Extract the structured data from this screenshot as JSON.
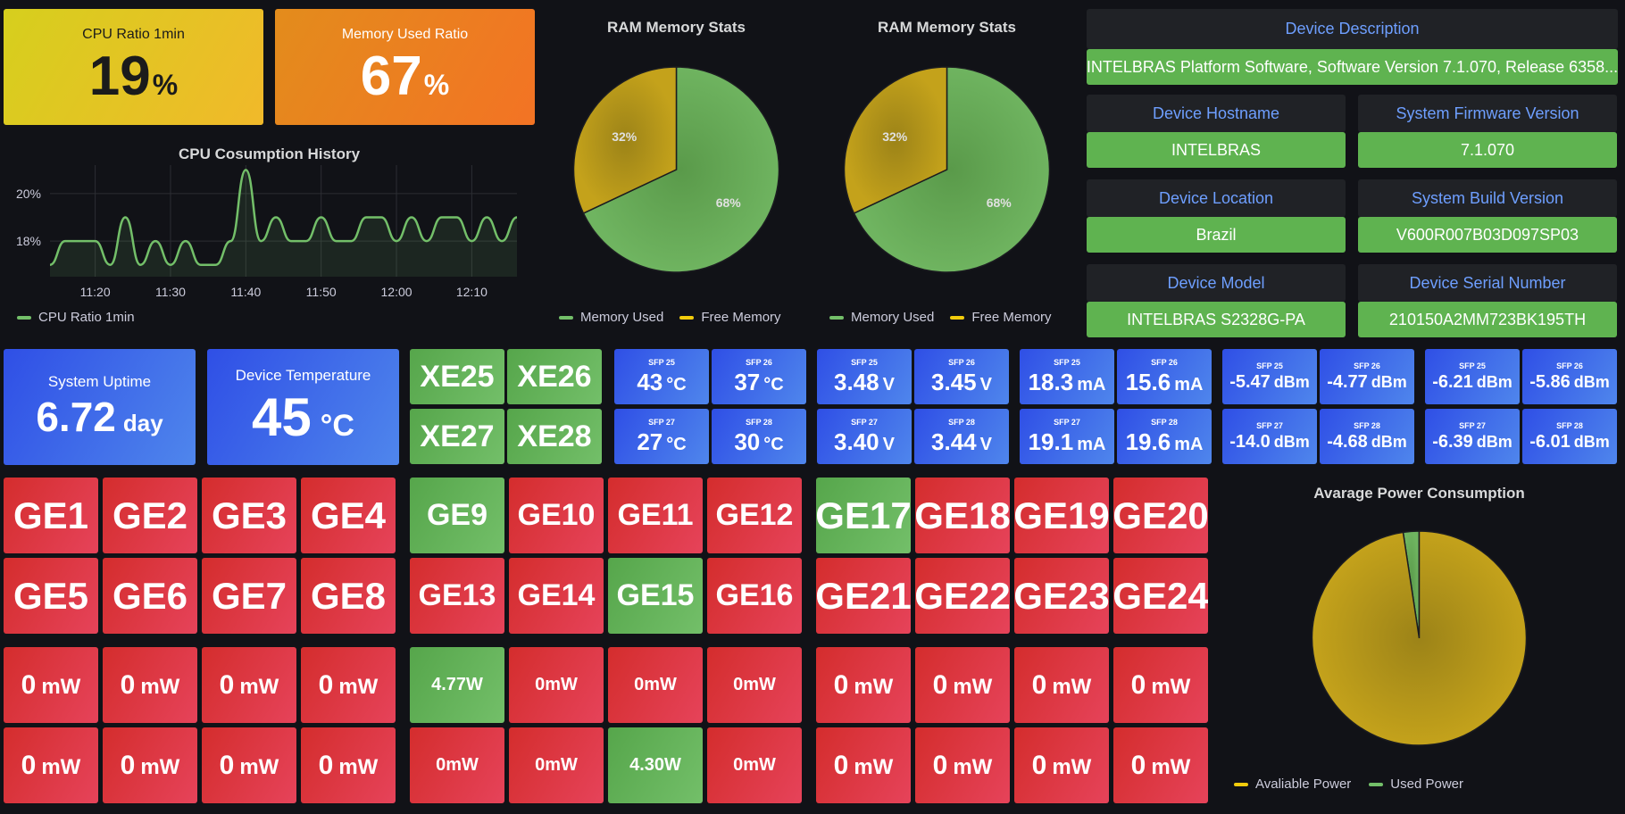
{
  "colors": {
    "red": "#e02f44",
    "green": "#73bf69",
    "blue": "#3d6be8",
    "yellow_gold": "#c4a218",
    "accent_label": "#6e9fff",
    "bg": "#111217"
  },
  "cpu_ratio": {
    "title": "CPU Ratio 1min",
    "value": "19",
    "unit": "%"
  },
  "mem_ratio": {
    "title": "Memory Used Ratio",
    "value": "67",
    "unit": "%"
  },
  "ram_stats": [
    {
      "title": "RAM Memory Stats",
      "used_pct": "68%",
      "free_pct": "32%",
      "legend_used": "Memory Used",
      "legend_free": "Free Memory"
    },
    {
      "title": "RAM Memory Stats",
      "used_pct": "68%",
      "free_pct": "32%",
      "legend_used": "Memory Used",
      "legend_free": "Free Memory"
    }
  ],
  "device": {
    "description_label": "Device Description",
    "description_value": "INTELBRAS Platform Software, Software Version 7.1.070, Release 6358...",
    "hostname_label": "Device Hostname",
    "hostname_value": "INTELBRAS",
    "firmware_label": "System Firmware Version",
    "firmware_value": "7.1.070",
    "location_label": "Device Location",
    "location_value": "Brazil",
    "build_label": "System Build Version",
    "build_value": "V600R007B03D097SP03",
    "model_label": "Device Model",
    "model_value": "INTELBRAS S2328G-PA",
    "serial_label": "Device Serial Number",
    "serial_value": "210150A2MM723BK195TH"
  },
  "uptime": {
    "title": "System Uptime",
    "value": "6.72",
    "unit": "day"
  },
  "temperature": {
    "title": "Device Temperature",
    "value": "45",
    "unit": "°C"
  },
  "xe_ports": [
    "XE25",
    "XE26",
    "XE27",
    "XE28"
  ],
  "sfp_temp": [
    {
      "label": "SFP 25",
      "value": "43",
      "unit": "°C"
    },
    {
      "label": "SFP 26",
      "value": "37",
      "unit": "°C"
    },
    {
      "label": "SFP 27",
      "value": "27",
      "unit": "°C"
    },
    {
      "label": "SFP 28",
      "value": "30",
      "unit": "°C"
    }
  ],
  "sfp_volt": [
    {
      "label": "SFP 25",
      "value": "3.48",
      "unit": "V"
    },
    {
      "label": "SFP 26",
      "value": "3.45",
      "unit": "V"
    },
    {
      "label": "SFP 27",
      "value": "3.40",
      "unit": "V"
    },
    {
      "label": "SFP 28",
      "value": "3.44",
      "unit": "V"
    }
  ],
  "sfp_bias": [
    {
      "label": "SFP 25",
      "value": "18.3",
      "unit": "mA"
    },
    {
      "label": "SFP 26",
      "value": "15.6",
      "unit": "mA"
    },
    {
      "label": "SFP 27",
      "value": "19.1",
      "unit": "mA"
    },
    {
      "label": "SFP 28",
      "value": "19.6",
      "unit": "mA"
    }
  ],
  "sfp_tx": [
    {
      "label": "SFP 25",
      "value": "-5.47",
      "unit": "dBm"
    },
    {
      "label": "SFP 26",
      "value": "-4.77",
      "unit": "dBm"
    },
    {
      "label": "SFP 27",
      "value": "-14.0",
      "unit": "dBm"
    },
    {
      "label": "SFP 28",
      "value": "-4.68",
      "unit": "dBm"
    }
  ],
  "sfp_rx": [
    {
      "label": "SFP 25",
      "value": "-6.21",
      "unit": "dBm"
    },
    {
      "label": "SFP 26",
      "value": "-5.86",
      "unit": "dBm"
    },
    {
      "label": "SFP 27",
      "value": "-6.39",
      "unit": "dBm"
    },
    {
      "label": "SFP 28",
      "value": "-6.01",
      "unit": "dBm"
    }
  ],
  "ge_ports": [
    {
      "name": "GE1",
      "up": false
    },
    {
      "name": "GE2",
      "up": false
    },
    {
      "name": "GE3",
      "up": false
    },
    {
      "name": "GE4",
      "up": false
    },
    {
      "name": "GE5",
      "up": false
    },
    {
      "name": "GE6",
      "up": false
    },
    {
      "name": "GE7",
      "up": false
    },
    {
      "name": "GE8",
      "up": false
    },
    {
      "name": "GE9",
      "up": true
    },
    {
      "name": "GE10",
      "up": false
    },
    {
      "name": "GE11",
      "up": false
    },
    {
      "name": "GE12",
      "up": false
    },
    {
      "name": "GE13",
      "up": false
    },
    {
      "name": "GE14",
      "up": false
    },
    {
      "name": "GE15",
      "up": true
    },
    {
      "name": "GE16",
      "up": false
    },
    {
      "name": "GE17",
      "up": true
    },
    {
      "name": "GE18",
      "up": false
    },
    {
      "name": "GE19",
      "up": false
    },
    {
      "name": "GE20",
      "up": false
    },
    {
      "name": "GE21",
      "up": false
    },
    {
      "name": "GE22",
      "up": false
    },
    {
      "name": "GE23",
      "up": false
    },
    {
      "name": "GE24",
      "up": false
    }
  ],
  "poe_power": [
    {
      "value": "0",
      "unit": "mW"
    },
    {
      "value": "0",
      "unit": "mW"
    },
    {
      "value": "0",
      "unit": "mW"
    },
    {
      "value": "0",
      "unit": "mW"
    },
    {
      "value": "0",
      "unit": "mW"
    },
    {
      "value": "0",
      "unit": "mW"
    },
    {
      "value": "0",
      "unit": "mW"
    },
    {
      "value": "0",
      "unit": "mW"
    },
    {
      "value": "4.77",
      "unit": "W"
    },
    {
      "value": "0",
      "unit": "mW"
    },
    {
      "value": "0",
      "unit": "mW"
    },
    {
      "value": "0",
      "unit": "mW"
    },
    {
      "value": "0",
      "unit": "mW"
    },
    {
      "value": "0",
      "unit": "mW"
    },
    {
      "value": "4.30",
      "unit": "W"
    },
    {
      "value": "0",
      "unit": "mW"
    },
    {
      "value": "0",
      "unit": "mW"
    },
    {
      "value": "0",
      "unit": "mW"
    },
    {
      "value": "0",
      "unit": "mW"
    },
    {
      "value": "0",
      "unit": "mW"
    },
    {
      "value": "0",
      "unit": "mW"
    },
    {
      "value": "0",
      "unit": "mW"
    },
    {
      "value": "0",
      "unit": "mW"
    },
    {
      "value": "0",
      "unit": "mW"
    }
  ],
  "cpu_history": {
    "title": "CPU Cosumption History",
    "legend": "CPU Ratio 1min"
  },
  "power_consumption": {
    "title": "Avarage Power Consumption",
    "legend_available": "Avaliable Power",
    "legend_used": "Used Power"
  },
  "chart_data": [
    {
      "type": "line",
      "title": "CPU Cosumption History",
      "x": [
        "11:14",
        "11:16",
        "11:18",
        "11:20",
        "11:22",
        "11:24",
        "11:26",
        "11:28",
        "11:30",
        "11:32",
        "11:34",
        "11:36",
        "11:38",
        "11:40",
        "11:42",
        "11:44",
        "11:46",
        "11:48",
        "11:50",
        "11:52",
        "11:54",
        "11:56",
        "11:58",
        "12:00",
        "12:02",
        "12:04",
        "12:06",
        "12:08",
        "12:10",
        "12:12",
        "12:14",
        "12:16"
      ],
      "x_ticks": [
        "11:20",
        "11:30",
        "11:40",
        "11:50",
        "12:00",
        "12:10"
      ],
      "series": [
        {
          "name": "CPU Ratio 1min",
          "values": [
            17,
            18,
            18,
            18,
            17,
            19,
            17,
            18,
            17,
            18,
            17,
            17,
            18,
            21,
            18,
            19,
            18,
            18,
            19,
            18,
            18,
            19,
            19,
            18,
            19,
            18,
            19,
            19,
            18,
            19,
            18,
            19
          ]
        }
      ],
      "y_ticks": [
        "18%",
        "20%"
      ],
      "ylim": [
        16.5,
        21.2
      ],
      "grid": true,
      "legend_position": "bottom-left"
    },
    {
      "type": "pie",
      "title": "RAM Memory Stats",
      "labels": [
        "Memory Used",
        "Free Memory"
      ],
      "values": [
        68,
        32
      ],
      "legend_position": "bottom"
    },
    {
      "type": "pie",
      "title": "RAM Memory Stats",
      "labels": [
        "Memory Used",
        "Free Memory"
      ],
      "values": [
        68,
        32
      ],
      "legend_position": "bottom"
    },
    {
      "type": "pie",
      "title": "Avarage Power Consumption",
      "labels": [
        "Avaliable Power",
        "Used Power"
      ],
      "values": [
        97.6,
        2.4
      ],
      "legend_position": "bottom"
    }
  ]
}
